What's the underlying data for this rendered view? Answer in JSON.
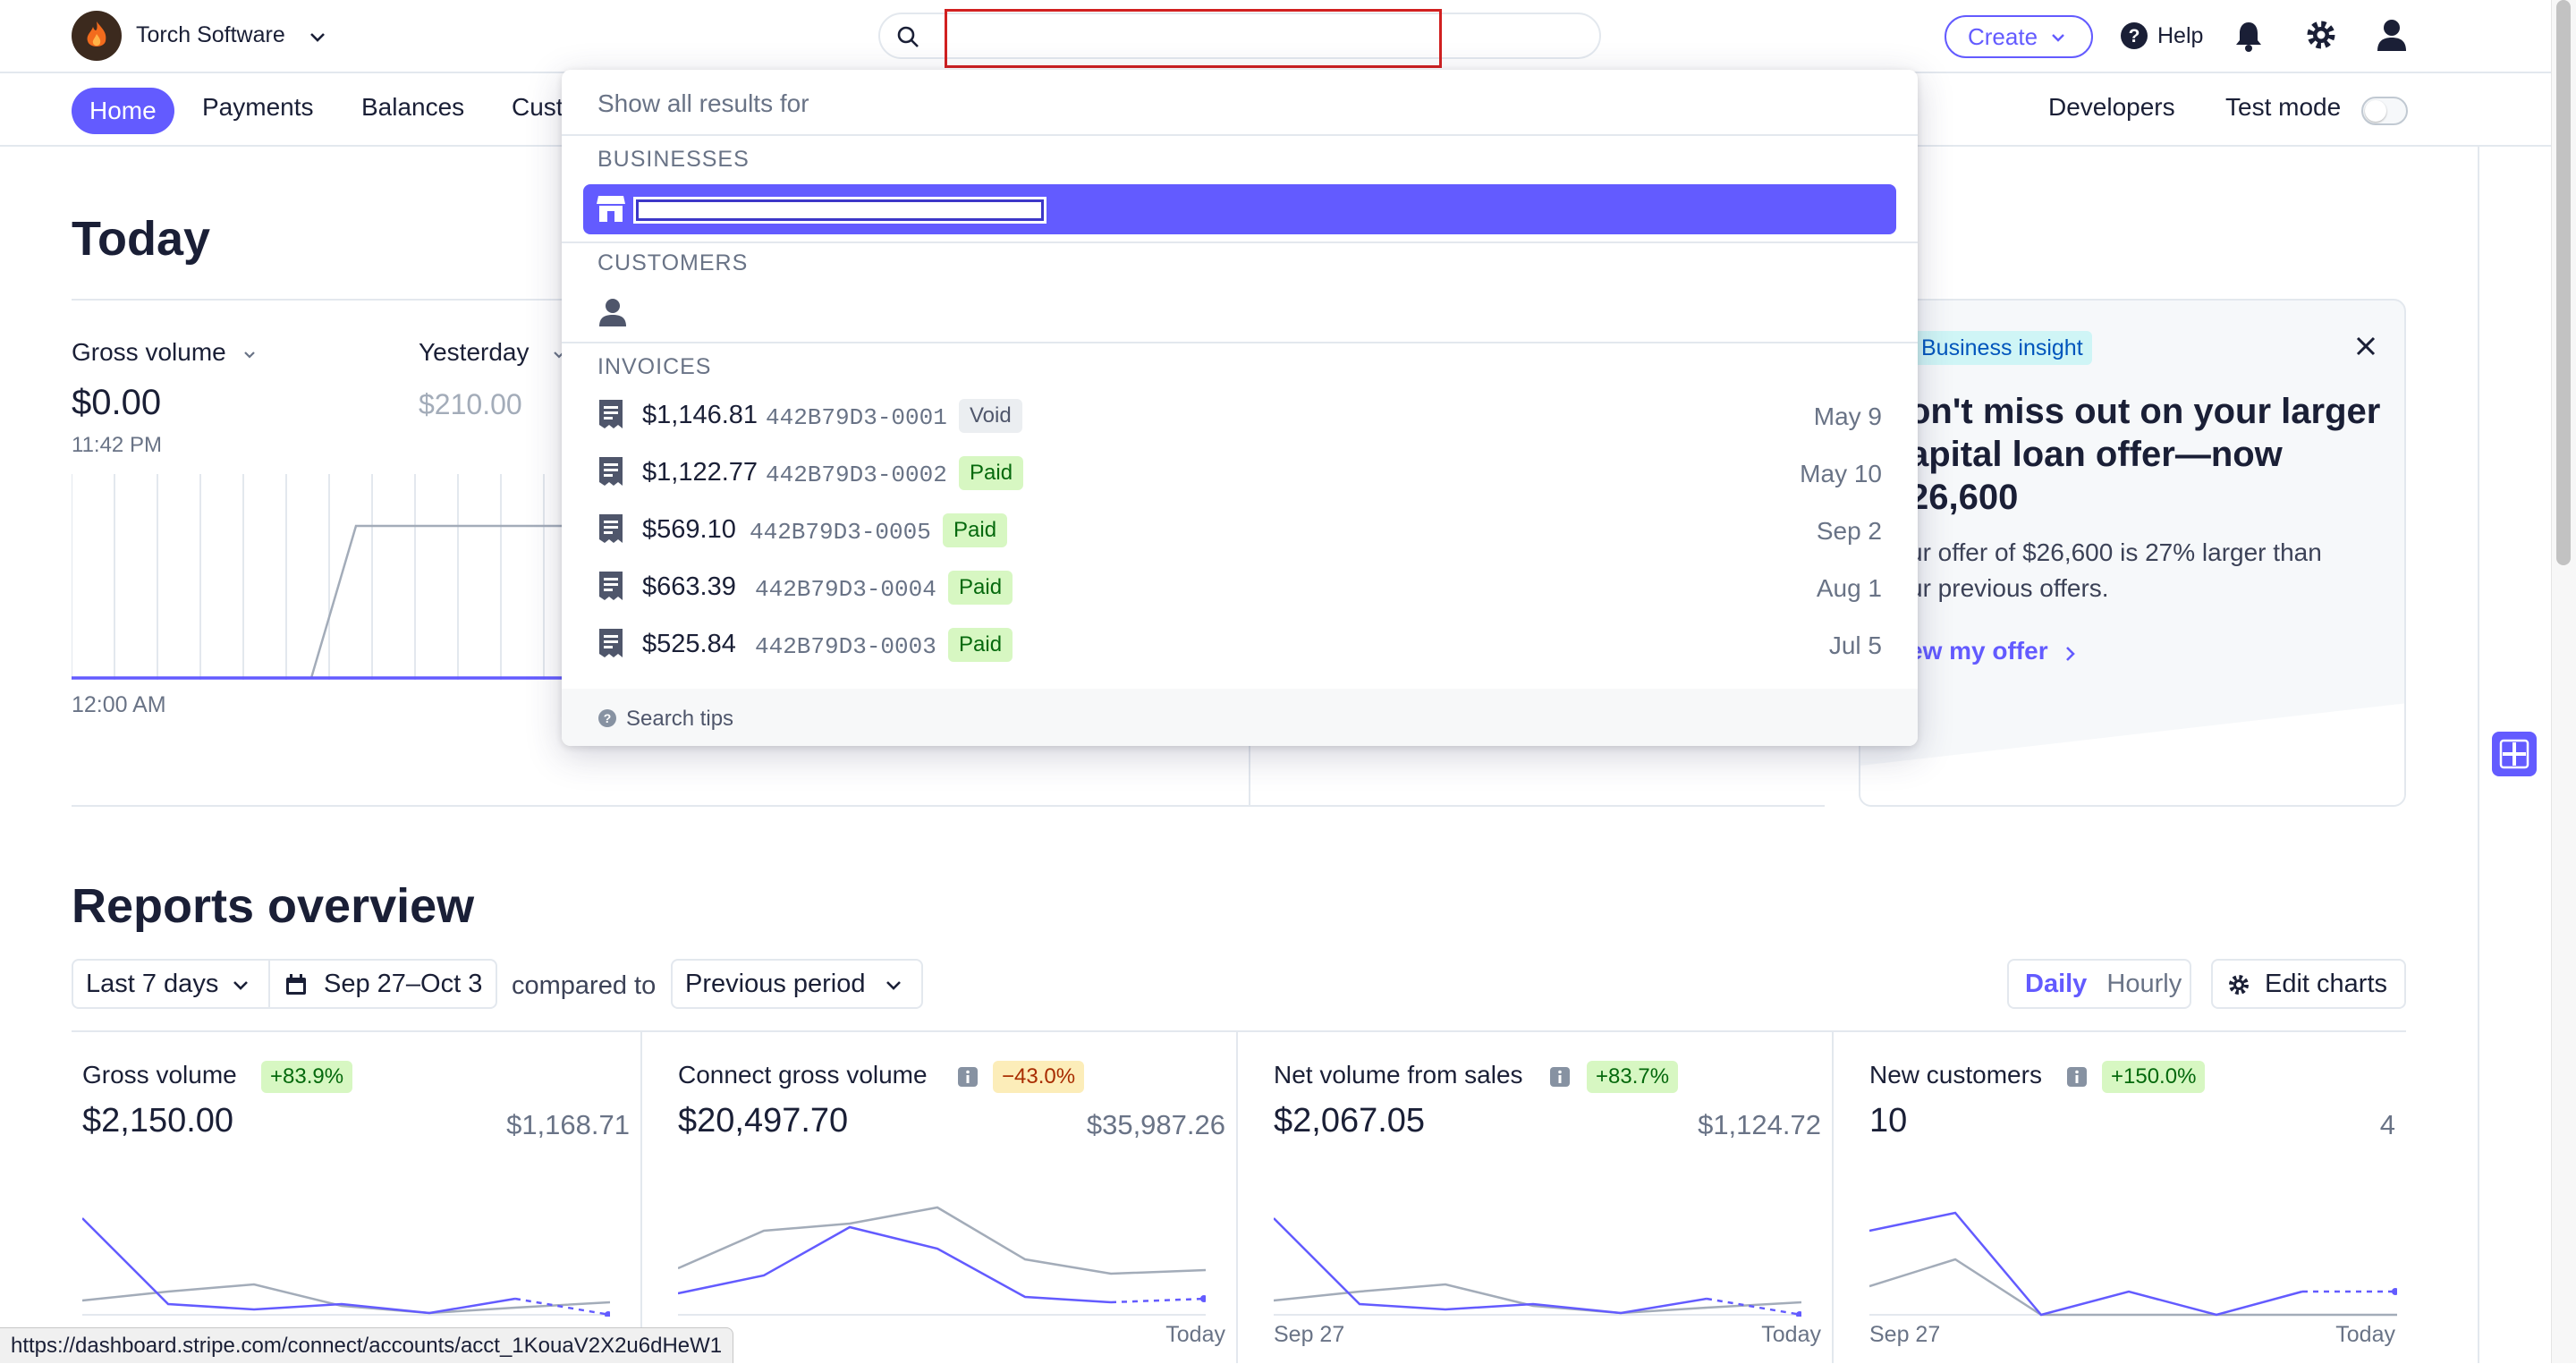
{
  "app": {
    "account_name": "Torch Software",
    "create_label": "Create",
    "help_label": "Help",
    "icons": [
      "torch-logo",
      "chevron-down-icon",
      "search-icon",
      "help-icon",
      "bell-icon",
      "gear-icon",
      "user-icon"
    ]
  },
  "nav": {
    "items": [
      "Home",
      "Payments",
      "Balances",
      "Cust"
    ],
    "developers": "Developers",
    "test_mode": "Test mode",
    "test_mode_on": false
  },
  "today": {
    "title": "Today",
    "gross_label": "Gross volume",
    "gross_value": "$0.00",
    "gross_time": "11:42 PM",
    "yesterday_label": "Yesterday",
    "yesterday_value": "$210.00",
    "axis_start": "12:00 AM"
  },
  "search": {
    "value": "",
    "show_all": "Show all results for",
    "businesses_header": "BUSINESSES",
    "customers_header": "CUSTOMERS",
    "invoices_header": "INVOICES",
    "invoices": [
      {
        "amount": "$1,146.81",
        "id": "442B79D3-0001",
        "status": "Void",
        "date": "May 9"
      },
      {
        "amount": "$1,122.77",
        "id": "442B79D3-0002",
        "status": "Paid",
        "date": "May 10"
      },
      {
        "amount": "$569.10",
        "id": "442B79D3-0005",
        "status": "Paid",
        "date": "Sep 2"
      },
      {
        "amount": "$663.39",
        "id": "442B79D3-0004",
        "status": "Paid",
        "date": "Aug 1"
      },
      {
        "amount": "$525.84",
        "id": "442B79D3-0003",
        "status": "Paid",
        "date": "Jul 5"
      }
    ],
    "tips": "Search tips"
  },
  "insight": {
    "badge": "Business insight",
    "title_lines": [
      "on't miss out on your larger",
      "apital loan offer—now",
      "26,600"
    ],
    "body_lines": [
      "ur offer of $26,600 is 27% larger than",
      "ur previous offers."
    ],
    "link": "ew my offer"
  },
  "reports": {
    "title": "Reports overview",
    "range": "Last 7 days",
    "dates": "Sep 27–Oct 3",
    "compared_to": "compared to",
    "compare_period": "Previous period",
    "daily": "Daily",
    "hourly": "Hourly",
    "edit_charts": "Edit charts",
    "cards": [
      {
        "title": "Gross volume",
        "delta": "+83.9%",
        "delta_tone": "up",
        "value": "$2,150.00",
        "previous": "$1,168.71",
        "info": false,
        "start": "",
        "end": ""
      },
      {
        "title": "Connect gross volume",
        "delta": "−43.0%",
        "delta_tone": "down",
        "value": "$20,497.70",
        "previous": "$35,987.26",
        "info": true,
        "start": "",
        "end": "Today"
      },
      {
        "title": "Net volume from sales",
        "delta": "+83.7%",
        "delta_tone": "up",
        "value": "$2,067.05",
        "previous": "$1,124.72",
        "info": true,
        "start": "Sep 27",
        "end": "Today"
      },
      {
        "title": "New customers",
        "delta": "+150.0%",
        "delta_tone": "up",
        "value": "10",
        "previous": "4",
        "info": true,
        "start": "Sep 27",
        "end": "Today"
      }
    ]
  },
  "status_url": "https://dashboard.stripe.com/connect/accounts/acct_1KouaV2X2u6dHeW1",
  "colors": {
    "accent": "#635bff",
    "paid_bg": "#d7f7c2",
    "paid_fg": "#05690d",
    "void_bg": "#ebeef1",
    "warn_bg": "#fcedb9",
    "warn_fg": "#a82c00"
  }
}
